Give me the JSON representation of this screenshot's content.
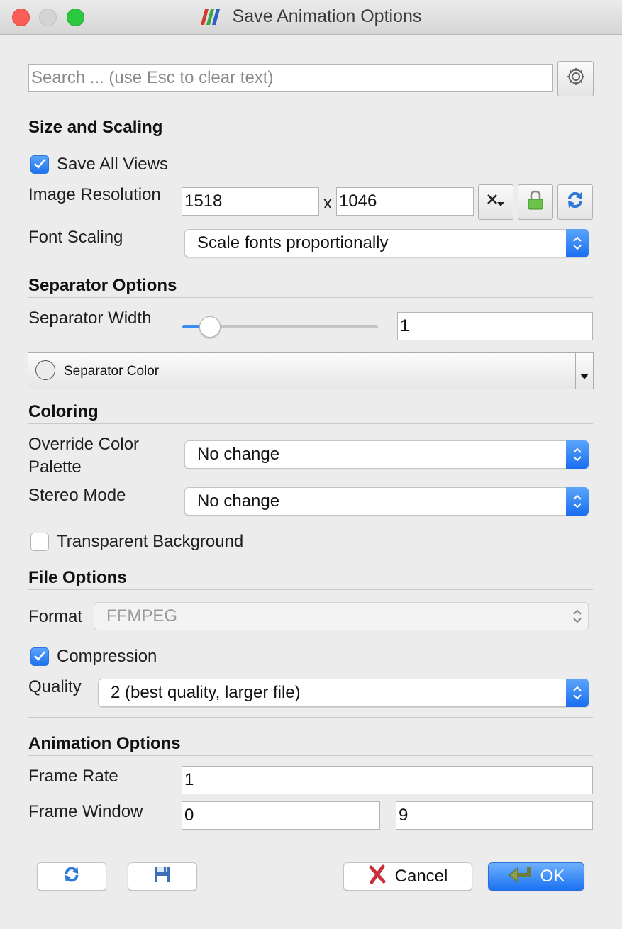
{
  "window": {
    "title": "Save Animation Options"
  },
  "search": {
    "placeholder": "Search ... (use Esc to clear text)"
  },
  "size_scaling": {
    "heading": "Size and Scaling",
    "save_all_views": {
      "label": "Save All Views",
      "checked": true
    },
    "image_resolution": {
      "label": "Image Resolution",
      "width": "1518",
      "separator": "x",
      "height": "1046"
    },
    "font_scaling": {
      "label": "Font Scaling",
      "value": "Scale fonts proportionally"
    }
  },
  "separator": {
    "heading": "Separator Options",
    "width": {
      "label": "Separator Width",
      "value": "1",
      "slider_fraction": 0.1
    },
    "color": {
      "label": "Separator Color"
    }
  },
  "coloring": {
    "heading": "Coloring",
    "override_palette": {
      "label_line1": "Override Color",
      "label_line2": "Palette",
      "value": "No change"
    },
    "stereo_mode": {
      "label": "Stereo Mode",
      "value": "No change"
    },
    "transparent_background": {
      "label": "Transparent Background",
      "checked": false
    }
  },
  "file_options": {
    "heading": "File Options",
    "format": {
      "label": "Format",
      "value": "FFMPEG",
      "enabled": false
    },
    "compression": {
      "label": "Compression",
      "checked": true
    },
    "quality": {
      "label": "Quality",
      "value": "2 (best quality, larger file)"
    }
  },
  "animation": {
    "heading": "Animation Options",
    "frame_rate": {
      "label": "Frame Rate",
      "value": "1"
    },
    "frame_window": {
      "label": "Frame Window",
      "start": "0",
      "end": "9"
    }
  },
  "buttons": {
    "cancel": "Cancel",
    "ok": "OK"
  },
  "colors": {
    "accent": "#1b72f2",
    "background": "#ececec"
  }
}
